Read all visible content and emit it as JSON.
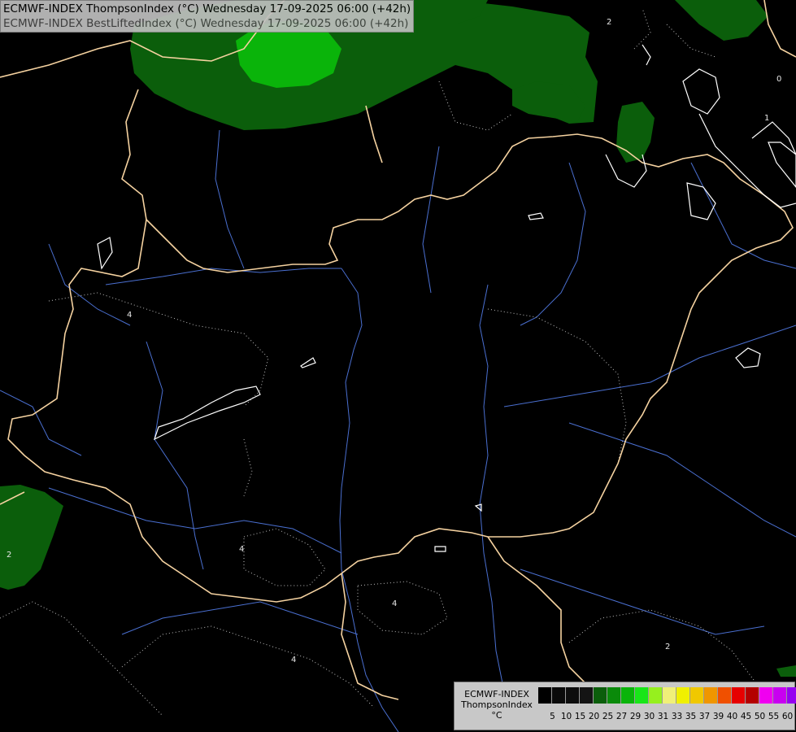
{
  "title": {
    "line1": "ECMWF-INDEX ThompsonIndex (°C) Wednesday 17-09-2025 06:00 (+42h)",
    "line2": "ECMWF-INDEX BestLiftedIndex (°C) Wednesday 17-09-2025 06:00 (+42h)"
  },
  "legend": {
    "title_line1": "ECMWF-INDEX",
    "title_line2": "ThompsonIndex",
    "unit": "°C",
    "ticks": [
      "5",
      "10",
      "15",
      "20",
      "25",
      "27",
      "29",
      "30",
      "31",
      "33",
      "35",
      "37",
      "39",
      "40",
      "45",
      "50",
      "55",
      "60"
    ],
    "colors": [
      "#000000",
      "#0a0a0a",
      "#0d0d0d",
      "#141414",
      "#0b5e0b",
      "#0a8a0a",
      "#0ab40a",
      "#18e618",
      "#96f01e",
      "#f0f078",
      "#f0f000",
      "#f0c800",
      "#f09600",
      "#f05000",
      "#e60000",
      "#b40000",
      "#f000f0",
      "#c800f0",
      "#9600f0",
      "#0000f0"
    ]
  },
  "map": {
    "contour_labels": [
      "0",
      "1",
      "2",
      "2",
      "2",
      "4",
      "4",
      "4",
      "4"
    ],
    "colors": {
      "border": "#f5d2a0",
      "river": "#4a6fd0",
      "fill_green_dark": "#0b5e0b",
      "fill_green_mid": "#0a8a0a",
      "fill_green_light": "#0ab40a",
      "lifted_index_contour": "#ffffff",
      "dotted_contour": "#bfbfbf"
    }
  }
}
